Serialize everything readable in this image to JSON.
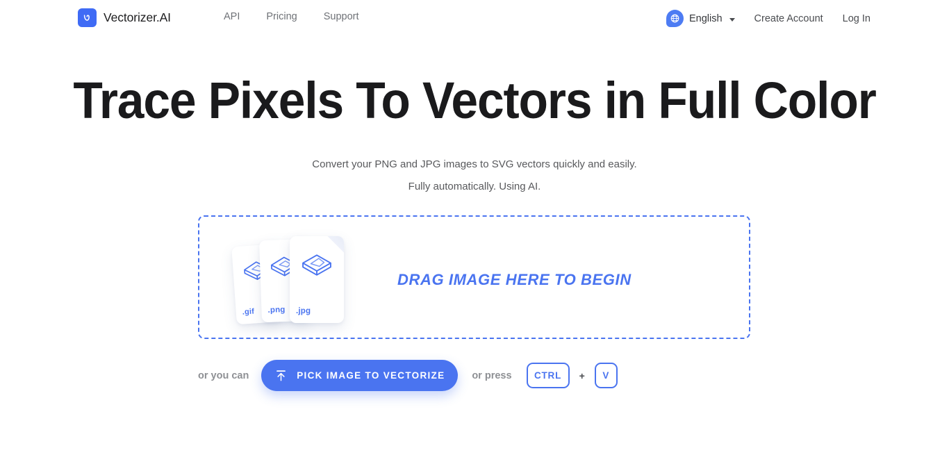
{
  "header": {
    "brand": {
      "name": "Vectorizer.AI",
      "logo_icon": "vectorizer-logo-icon",
      "logo_color": "#3f6bf5"
    },
    "nav": [
      {
        "label": "API",
        "name": "nav-link-api"
      },
      {
        "label": "Pricing",
        "name": "nav-link-pricing"
      },
      {
        "label": "Support",
        "name": "nav-link-support"
      }
    ],
    "language": {
      "label": "English",
      "icon": "globe-icon",
      "caret_icon": "caret-down-icon"
    },
    "create_account": "Create Account",
    "log_in": "Log In"
  },
  "hero": {
    "title": "Trace Pixels To Vectors in Full Color",
    "subtitle_line1": "Convert your PNG and JPG images to SVG vectors quickly and easily.",
    "subtitle_line2": "Fully automatically. Using AI."
  },
  "dropzone": {
    "drag_label": "DRAG IMAGE HERE TO BEGIN",
    "border_color": "#4a74f0",
    "files": [
      {
        "ext": ".gif",
        "icon": "image-file-icon"
      },
      {
        "ext": ".png",
        "icon": "image-file-icon"
      },
      {
        "ext": ".jpg",
        "icon": "image-file-icon"
      }
    ]
  },
  "actions": {
    "or_you_can": "or you can",
    "pick_button": "PICK IMAGE TO VECTORIZE",
    "pick_button_icon": "upload-icon",
    "pick_button_color": "#4a74f0",
    "or_press": "or press",
    "key_ctrl": "CTRL",
    "key_plus": "+",
    "key_v": "V"
  }
}
